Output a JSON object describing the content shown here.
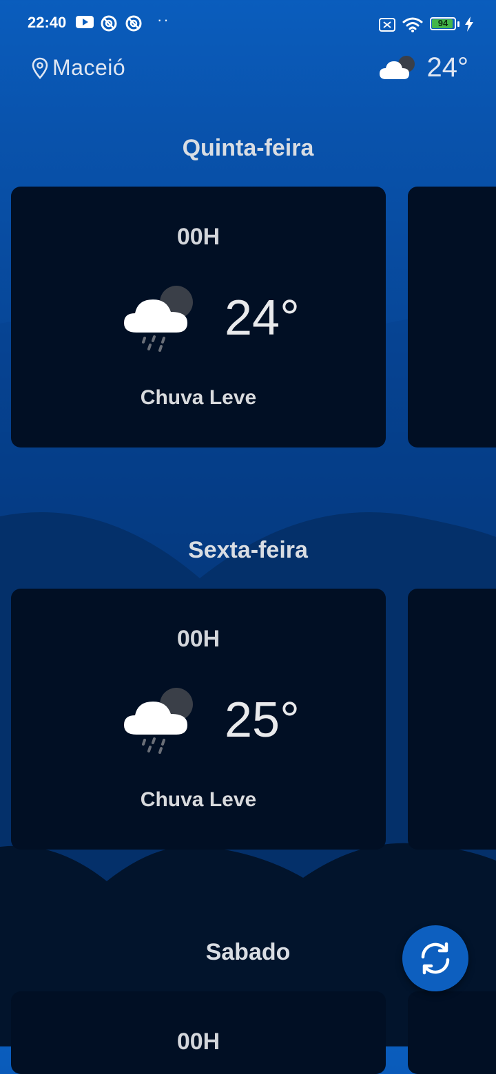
{
  "status_bar": {
    "time": "22:40",
    "battery": "94",
    "battery_level": 0.94,
    "icons": [
      "youtube-icon",
      "notification-icon",
      "notification-icon",
      "more-dots-icon",
      "no-sim-icon",
      "wifi-icon",
      "battery-icon",
      "charging-icon"
    ]
  },
  "header": {
    "location": "Maceió",
    "location_icon": "location-pin-icon",
    "weather_icon": "cloudy-night-icon",
    "temperature": "24°"
  },
  "days": [
    {
      "name": "Quinta-feira",
      "forecast": {
        "hour": "00H",
        "temperature": "24°",
        "condition": "Chuva Leve",
        "icon": "light-rain-night-icon"
      }
    },
    {
      "name": "Sexta-feira",
      "forecast": {
        "hour": "00H",
        "temperature": "25°",
        "condition": "Chuva Leve",
        "icon": "light-rain-night-icon"
      }
    },
    {
      "name": "Sabado",
      "forecast": {
        "hour": "00H"
      }
    }
  ],
  "actions": {
    "refresh_icon": "refresh-icon"
  },
  "colors": {
    "primary": "#0d5fbf",
    "card": "#010f24",
    "text": "#d9dde3"
  }
}
